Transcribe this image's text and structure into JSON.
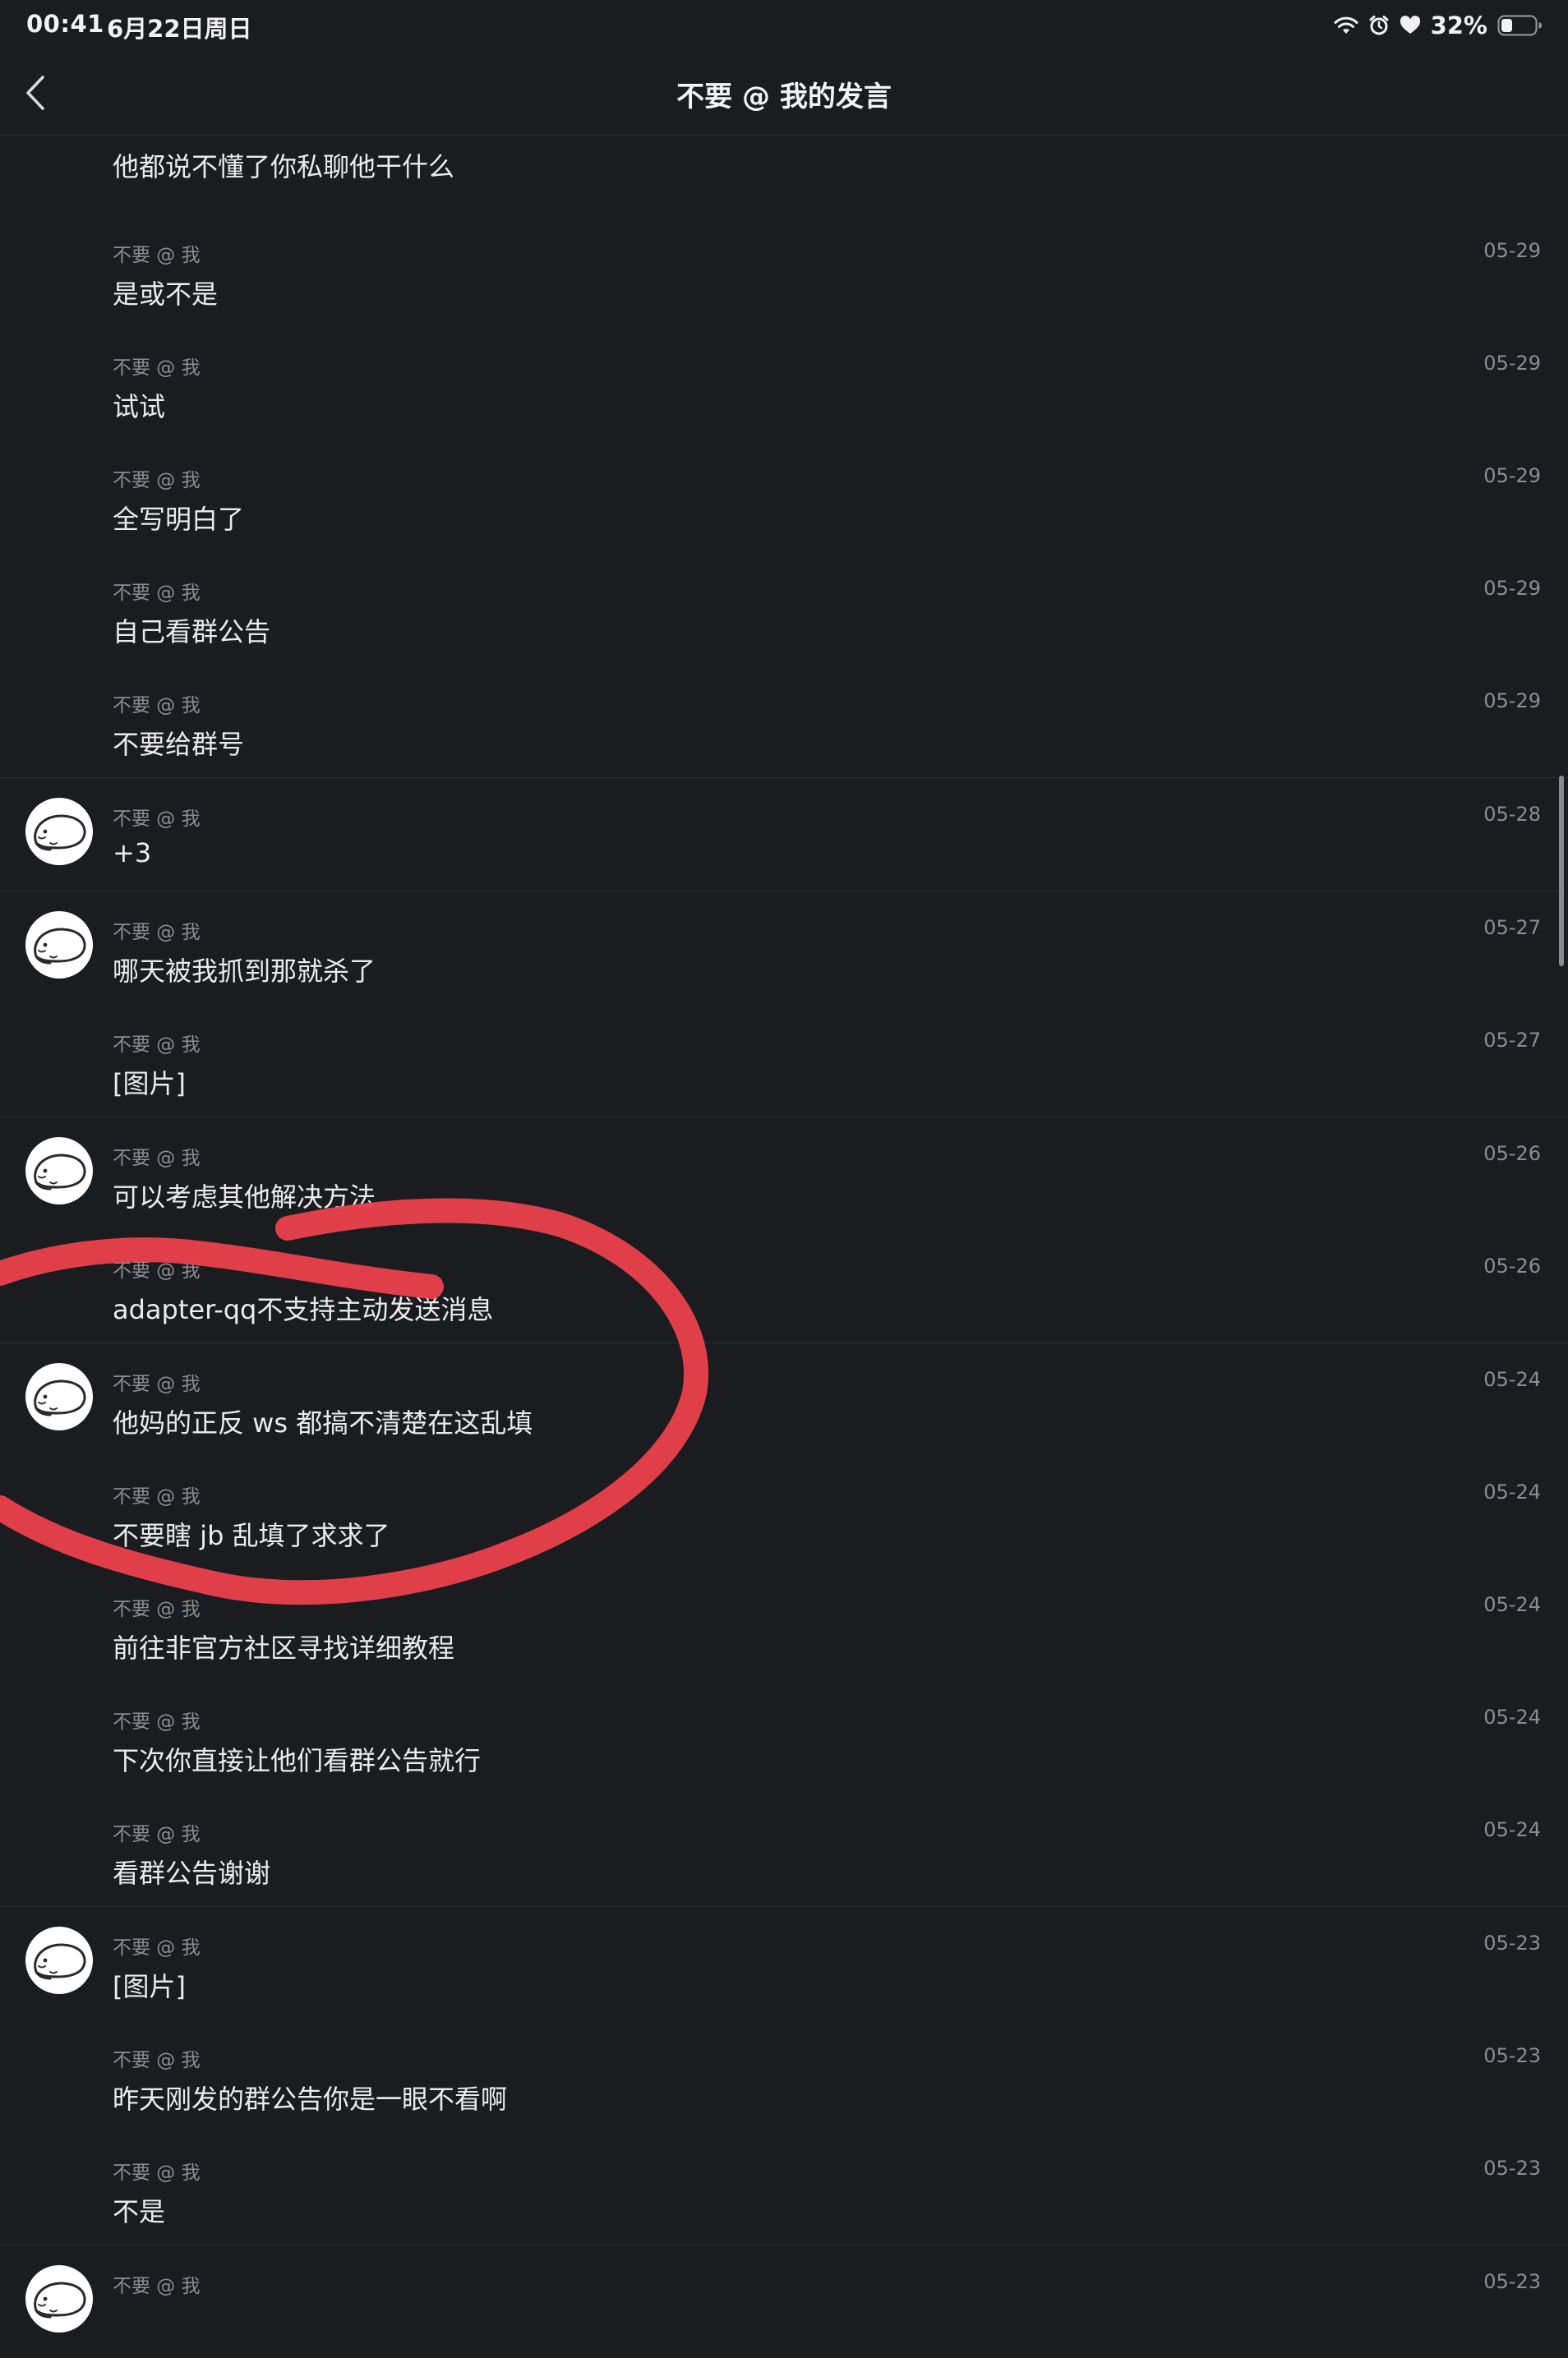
{
  "status_bar": {
    "time": "00:41",
    "date": "6月22日周日",
    "battery": "32%"
  },
  "nav": {
    "title": "不要 @ 我的发言"
  },
  "colors": {
    "background": "#1b1c20",
    "annotation": "#e8414c"
  },
  "messages": [
    {
      "sender": "",
      "date": "",
      "text": "他都说不懂了你私聊他干什么"
    },
    {
      "sender": "不要 @ 我",
      "date": "05-29",
      "text": "是或不是"
    },
    {
      "sender": "不要 @ 我",
      "date": "05-29",
      "text": "试试"
    },
    {
      "sender": "不要 @ 我",
      "date": "05-29",
      "text": "全写明白了"
    },
    {
      "sender": "不要 @ 我",
      "date": "05-29",
      "text": "自己看群公告"
    },
    {
      "sender": "不要 @ 我",
      "date": "05-29",
      "text": "不要给群号"
    },
    {
      "sender": "不要 @ 我",
      "date": "05-28",
      "text": "+3"
    },
    {
      "sender": "不要 @ 我",
      "date": "05-27",
      "text": "哪天被我抓到那就杀了"
    },
    {
      "sender": "不要 @ 我",
      "date": "05-27",
      "text": "[图片]"
    },
    {
      "sender": "不要 @ 我",
      "date": "05-26",
      "text": "可以考虑其他解决方法"
    },
    {
      "sender": "不要 @ 我",
      "date": "05-26",
      "text": "adapter-qq不支持主动发送消息"
    },
    {
      "sender": "不要 @ 我",
      "date": "05-24",
      "text": "他妈的正反 ws 都搞不清楚在这乱填"
    },
    {
      "sender": "不要 @ 我",
      "date": "05-24",
      "text": "不要瞎 jb 乱填了求求了"
    },
    {
      "sender": "不要 @ 我",
      "date": "05-24",
      "text": "前往非官方社区寻找详细教程"
    },
    {
      "sender": "不要 @ 我",
      "date": "05-24",
      "text": "下次你直接让他们看群公告就行"
    },
    {
      "sender": "不要 @ 我",
      "date": "05-24",
      "text": "看群公告谢谢"
    },
    {
      "sender": "不要 @ 我",
      "date": "05-23",
      "text": "[图片]"
    },
    {
      "sender": "不要 @ 我",
      "date": "05-23",
      "text": "昨天刚发的群公告你是一眼不看啊"
    },
    {
      "sender": "不要 @ 我",
      "date": "05-23",
      "text": "不是"
    },
    {
      "sender": "不要 @ 我",
      "date": "05-23",
      "text": ""
    }
  ]
}
